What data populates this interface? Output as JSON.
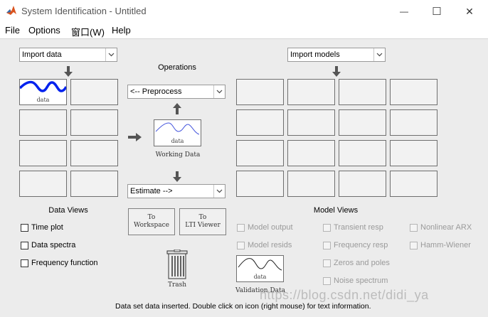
{
  "window": {
    "title": "System Identification - Untitled",
    "controls": {
      "minimize": "—",
      "maximize": "☐",
      "close": "✕"
    }
  },
  "menu": [
    {
      "label": "File"
    },
    {
      "label": "Options"
    },
    {
      "label": "窗口(W)"
    },
    {
      "label": "Help"
    }
  ],
  "data_panel": {
    "import_label": "Import data",
    "first_slot_label": "data",
    "views_title": "Data Views",
    "views": [
      {
        "label": "Time plot"
      },
      {
        "label": "Data spectra"
      },
      {
        "label": "Frequency function"
      }
    ]
  },
  "operations": {
    "title": "Operations",
    "preprocess_label": "<-- Preprocess",
    "working_data_slot_label": "data",
    "working_data_caption": "Working Data",
    "estimate_label": "Estimate -->",
    "to_workspace": [
      "To",
      "Workspace"
    ],
    "to_lti_viewer": [
      "To",
      "LTI Viewer"
    ],
    "trash_label": "Trash",
    "validation_slot_label": "data",
    "validation_caption": "Validation Data"
  },
  "model_panel": {
    "import_label": "Import models",
    "views_title": "Model Views",
    "views": [
      {
        "label": "Model output"
      },
      {
        "label": "Transient resp"
      },
      {
        "label": "Nonlinear ARX"
      },
      {
        "label": "Model resids"
      },
      {
        "label": "Frequency resp"
      },
      {
        "label": "Hamm-Wiener"
      },
      {
        "label": "Zeros and poles"
      },
      {
        "label": "Noise spectrum"
      }
    ]
  },
  "status": "Data set data inserted.  Double click on icon (right mouse) for text information.",
  "watermark": "https://blog.csdn.net/didi_ya",
  "colors": {
    "data_thick": "#0022ee",
    "data_thin": "#4455dd",
    "validation_line": "#222222"
  }
}
